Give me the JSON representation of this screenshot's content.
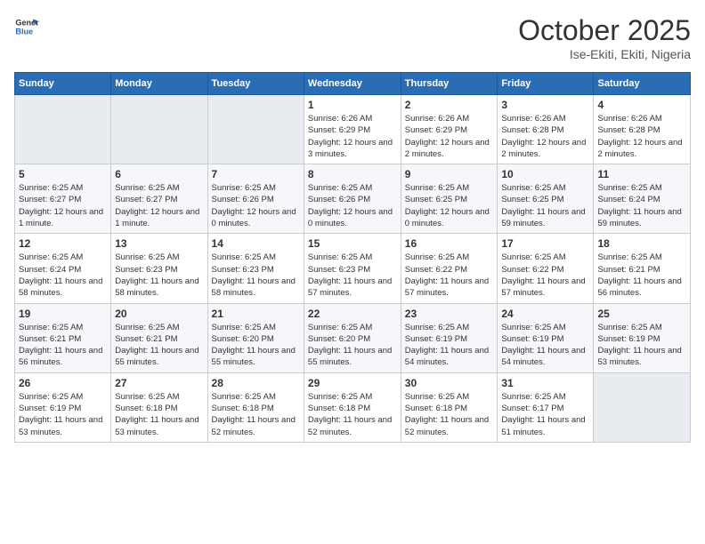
{
  "header": {
    "logo_line1": "General",
    "logo_line2": "Blue",
    "month": "October 2025",
    "location": "Ise-Ekiti, Ekiti, Nigeria"
  },
  "weekdays": [
    "Sunday",
    "Monday",
    "Tuesday",
    "Wednesday",
    "Thursday",
    "Friday",
    "Saturday"
  ],
  "weeks": [
    [
      {
        "day": "",
        "info": ""
      },
      {
        "day": "",
        "info": ""
      },
      {
        "day": "",
        "info": ""
      },
      {
        "day": "1",
        "info": "Sunrise: 6:26 AM\nSunset: 6:29 PM\nDaylight: 12 hours and 3 minutes."
      },
      {
        "day": "2",
        "info": "Sunrise: 6:26 AM\nSunset: 6:29 PM\nDaylight: 12 hours and 2 minutes."
      },
      {
        "day": "3",
        "info": "Sunrise: 6:26 AM\nSunset: 6:28 PM\nDaylight: 12 hours and 2 minutes."
      },
      {
        "day": "4",
        "info": "Sunrise: 6:26 AM\nSunset: 6:28 PM\nDaylight: 12 hours and 2 minutes."
      }
    ],
    [
      {
        "day": "5",
        "info": "Sunrise: 6:25 AM\nSunset: 6:27 PM\nDaylight: 12 hours and 1 minute."
      },
      {
        "day": "6",
        "info": "Sunrise: 6:25 AM\nSunset: 6:27 PM\nDaylight: 12 hours and 1 minute."
      },
      {
        "day": "7",
        "info": "Sunrise: 6:25 AM\nSunset: 6:26 PM\nDaylight: 12 hours and 0 minutes."
      },
      {
        "day": "8",
        "info": "Sunrise: 6:25 AM\nSunset: 6:26 PM\nDaylight: 12 hours and 0 minutes."
      },
      {
        "day": "9",
        "info": "Sunrise: 6:25 AM\nSunset: 6:25 PM\nDaylight: 12 hours and 0 minutes."
      },
      {
        "day": "10",
        "info": "Sunrise: 6:25 AM\nSunset: 6:25 PM\nDaylight: 11 hours and 59 minutes."
      },
      {
        "day": "11",
        "info": "Sunrise: 6:25 AM\nSunset: 6:24 PM\nDaylight: 11 hours and 59 minutes."
      }
    ],
    [
      {
        "day": "12",
        "info": "Sunrise: 6:25 AM\nSunset: 6:24 PM\nDaylight: 11 hours and 58 minutes."
      },
      {
        "day": "13",
        "info": "Sunrise: 6:25 AM\nSunset: 6:23 PM\nDaylight: 11 hours and 58 minutes."
      },
      {
        "day": "14",
        "info": "Sunrise: 6:25 AM\nSunset: 6:23 PM\nDaylight: 11 hours and 58 minutes."
      },
      {
        "day": "15",
        "info": "Sunrise: 6:25 AM\nSunset: 6:23 PM\nDaylight: 11 hours and 57 minutes."
      },
      {
        "day": "16",
        "info": "Sunrise: 6:25 AM\nSunset: 6:22 PM\nDaylight: 11 hours and 57 minutes."
      },
      {
        "day": "17",
        "info": "Sunrise: 6:25 AM\nSunset: 6:22 PM\nDaylight: 11 hours and 57 minutes."
      },
      {
        "day": "18",
        "info": "Sunrise: 6:25 AM\nSunset: 6:21 PM\nDaylight: 11 hours and 56 minutes."
      }
    ],
    [
      {
        "day": "19",
        "info": "Sunrise: 6:25 AM\nSunset: 6:21 PM\nDaylight: 11 hours and 56 minutes."
      },
      {
        "day": "20",
        "info": "Sunrise: 6:25 AM\nSunset: 6:21 PM\nDaylight: 11 hours and 55 minutes."
      },
      {
        "day": "21",
        "info": "Sunrise: 6:25 AM\nSunset: 6:20 PM\nDaylight: 11 hours and 55 minutes."
      },
      {
        "day": "22",
        "info": "Sunrise: 6:25 AM\nSunset: 6:20 PM\nDaylight: 11 hours and 55 minutes."
      },
      {
        "day": "23",
        "info": "Sunrise: 6:25 AM\nSunset: 6:19 PM\nDaylight: 11 hours and 54 minutes."
      },
      {
        "day": "24",
        "info": "Sunrise: 6:25 AM\nSunset: 6:19 PM\nDaylight: 11 hours and 54 minutes."
      },
      {
        "day": "25",
        "info": "Sunrise: 6:25 AM\nSunset: 6:19 PM\nDaylight: 11 hours and 53 minutes."
      }
    ],
    [
      {
        "day": "26",
        "info": "Sunrise: 6:25 AM\nSunset: 6:19 PM\nDaylight: 11 hours and 53 minutes."
      },
      {
        "day": "27",
        "info": "Sunrise: 6:25 AM\nSunset: 6:18 PM\nDaylight: 11 hours and 53 minutes."
      },
      {
        "day": "28",
        "info": "Sunrise: 6:25 AM\nSunset: 6:18 PM\nDaylight: 11 hours and 52 minutes."
      },
      {
        "day": "29",
        "info": "Sunrise: 6:25 AM\nSunset: 6:18 PM\nDaylight: 11 hours and 52 minutes."
      },
      {
        "day": "30",
        "info": "Sunrise: 6:25 AM\nSunset: 6:18 PM\nDaylight: 11 hours and 52 minutes."
      },
      {
        "day": "31",
        "info": "Sunrise: 6:25 AM\nSunset: 6:17 PM\nDaylight: 11 hours and 51 minutes."
      },
      {
        "day": "",
        "info": ""
      }
    ]
  ]
}
